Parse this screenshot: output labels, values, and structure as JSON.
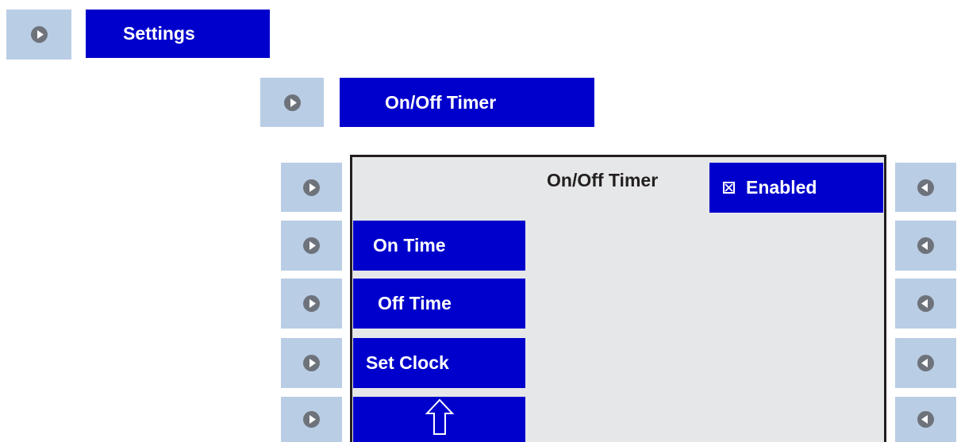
{
  "breadcrumb": {
    "level1": "Settings",
    "level2": "On/Off Timer"
  },
  "screen": {
    "title": "On/Off Timer",
    "enabled_label": "Enabled",
    "enabled_checked": true,
    "menu": {
      "on_time": "On Time",
      "off_time": "Off Time",
      "set_clock": "Set Clock",
      "home_icon": "up-arrow-icon"
    }
  },
  "colors": {
    "button_blue": "#0000cc",
    "screen_bg": "#e6e7e8",
    "softkey_bg": "#b9cde5",
    "knob": "#6e737b"
  }
}
